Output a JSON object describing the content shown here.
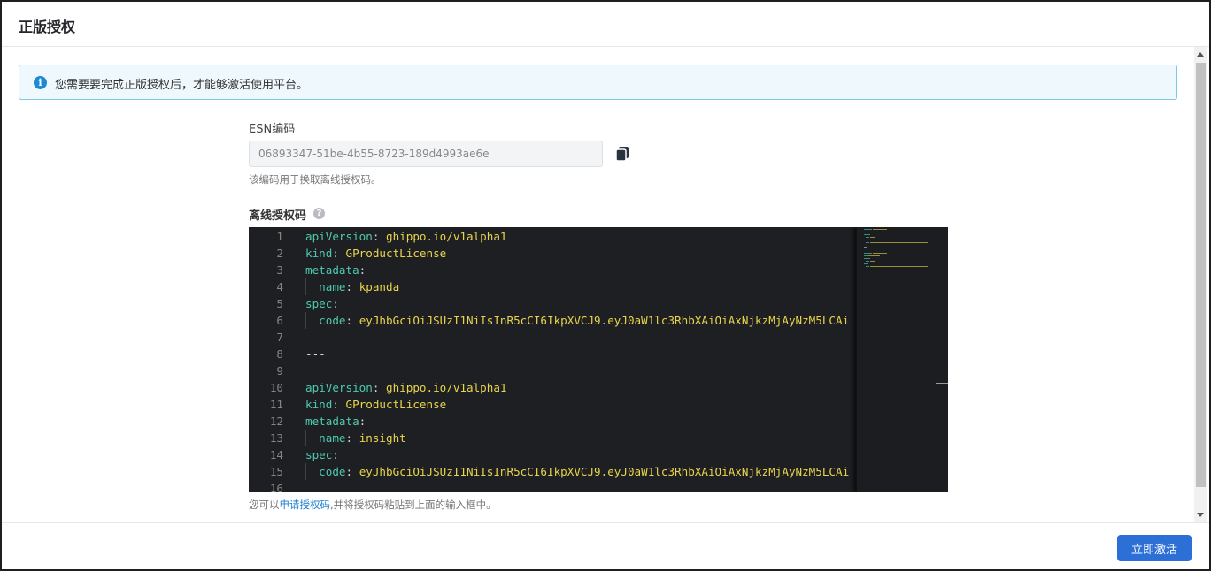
{
  "dialog": {
    "title": "正版授权",
    "alert_text": "您需要要完成正版授权后，才能够激活使用平台。",
    "esn": {
      "label": "ESN编码",
      "value": "06893347-51be-4b55-8723-189d4993ae6e",
      "hint": "该编码用于换取离线授权码。"
    },
    "offline": {
      "label": "离线授权码"
    },
    "editor": {
      "lines": [
        {
          "n": "1",
          "indent": 0,
          "key": "apiVersion",
          "sep": ": ",
          "val": "ghippo.io/v1alpha1"
        },
        {
          "n": "2",
          "indent": 0,
          "key": "kind",
          "sep": ": ",
          "val": "GProductLicense"
        },
        {
          "n": "3",
          "indent": 0,
          "key": "metadata",
          "sep": ":",
          "val": ""
        },
        {
          "n": "4",
          "indent": 1,
          "key": "name",
          "sep": ": ",
          "val": "kpanda"
        },
        {
          "n": "5",
          "indent": 0,
          "key": "spec",
          "sep": ":",
          "val": ""
        },
        {
          "n": "6",
          "indent": 1,
          "key": "code",
          "sep": ": ",
          "val": "eyJhbGciOiJSUzI1NiIsInR5cCI6IkpXVCJ9.eyJ0aW1lc3RhbXAiOiAxNjkzMjAyNzM5LCAi"
        },
        {
          "n": "7",
          "indent": 0,
          "key": "",
          "sep": "",
          "val": ""
        },
        {
          "n": "8",
          "indent": 0,
          "key": "",
          "sep": "---",
          "val": ""
        },
        {
          "n": "9",
          "indent": 0,
          "key": "",
          "sep": "",
          "val": ""
        },
        {
          "n": "10",
          "indent": 0,
          "key": "apiVersion",
          "sep": ": ",
          "val": "ghippo.io/v1alpha1"
        },
        {
          "n": "11",
          "indent": 0,
          "key": "kind",
          "sep": ": ",
          "val": "GProductLicense"
        },
        {
          "n": "12",
          "indent": 0,
          "key": "metadata",
          "sep": ":",
          "val": ""
        },
        {
          "n": "13",
          "indent": 1,
          "key": "name",
          "sep": ": ",
          "val": "insight"
        },
        {
          "n": "14",
          "indent": 0,
          "key": "spec",
          "sep": ":",
          "val": ""
        },
        {
          "n": "15",
          "indent": 1,
          "key": "code",
          "sep": ": ",
          "val": "eyJhbGciOiJSUzI1NiIsInR5cCI6IkpXVCJ9.eyJ0aW1lc3RhbXAiOiAxNjkzMjAyNzM5LCAi"
        },
        {
          "n": "16",
          "indent": 0,
          "key": "",
          "sep": "",
          "val": ""
        }
      ]
    },
    "footer_note": {
      "before": "您可以",
      "link": "申请授权码",
      "after": ",并将授权码粘贴到上面的输入框中。"
    },
    "activate_label": "立即激活"
  },
  "icons": {
    "info": "info-icon",
    "copy": "copy-icon",
    "help": "help-icon"
  },
  "colors": {
    "primary": "#2c6fd6",
    "alert_bg": "#eef8fd",
    "alert_border": "#7cc7ee",
    "editor_bg": "#1e1f22",
    "yaml_key": "#4ec9b0",
    "yaml_value": "#e8d44d"
  }
}
